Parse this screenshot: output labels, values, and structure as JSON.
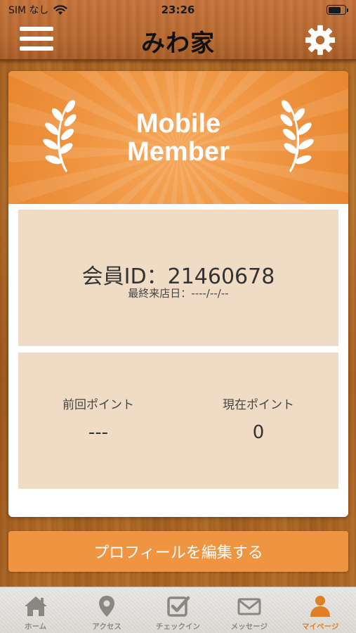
{
  "status_bar": {
    "carrier": "SIM なし",
    "time": "23:26"
  },
  "header": {
    "title": "みわ家",
    "menu_icon": "hamburger-menu-icon",
    "settings_icon": "gear-icon"
  },
  "banner": {
    "line1": "Mobile",
    "line2": "Member",
    "icon": "laurel-icon"
  },
  "member": {
    "id_text": "会員ID：21460678",
    "last_visit_text": "最終来店日：----/--/--"
  },
  "points": {
    "previous_label": "前回ポイント",
    "previous_value": "---",
    "current_label": "現在ポイント",
    "current_value": "0"
  },
  "edit_profile_label": "プロフィールを編集する",
  "tabs": [
    {
      "label": "ホーム",
      "icon": "home-icon",
      "active": false
    },
    {
      "label": "アクセス",
      "icon": "map-pin-icon",
      "active": false
    },
    {
      "label": "チェックイン",
      "icon": "checkin-icon",
      "active": false
    },
    {
      "label": "メッセージ",
      "icon": "mail-icon",
      "active": false
    },
    {
      "label": "マイページ",
      "icon": "person-icon",
      "active": true
    }
  ],
  "colors": {
    "accent": "#ef9440",
    "panel": "#f0dcc5",
    "tab_inactive": "#8a8783",
    "tab_active": "#e07f25"
  }
}
